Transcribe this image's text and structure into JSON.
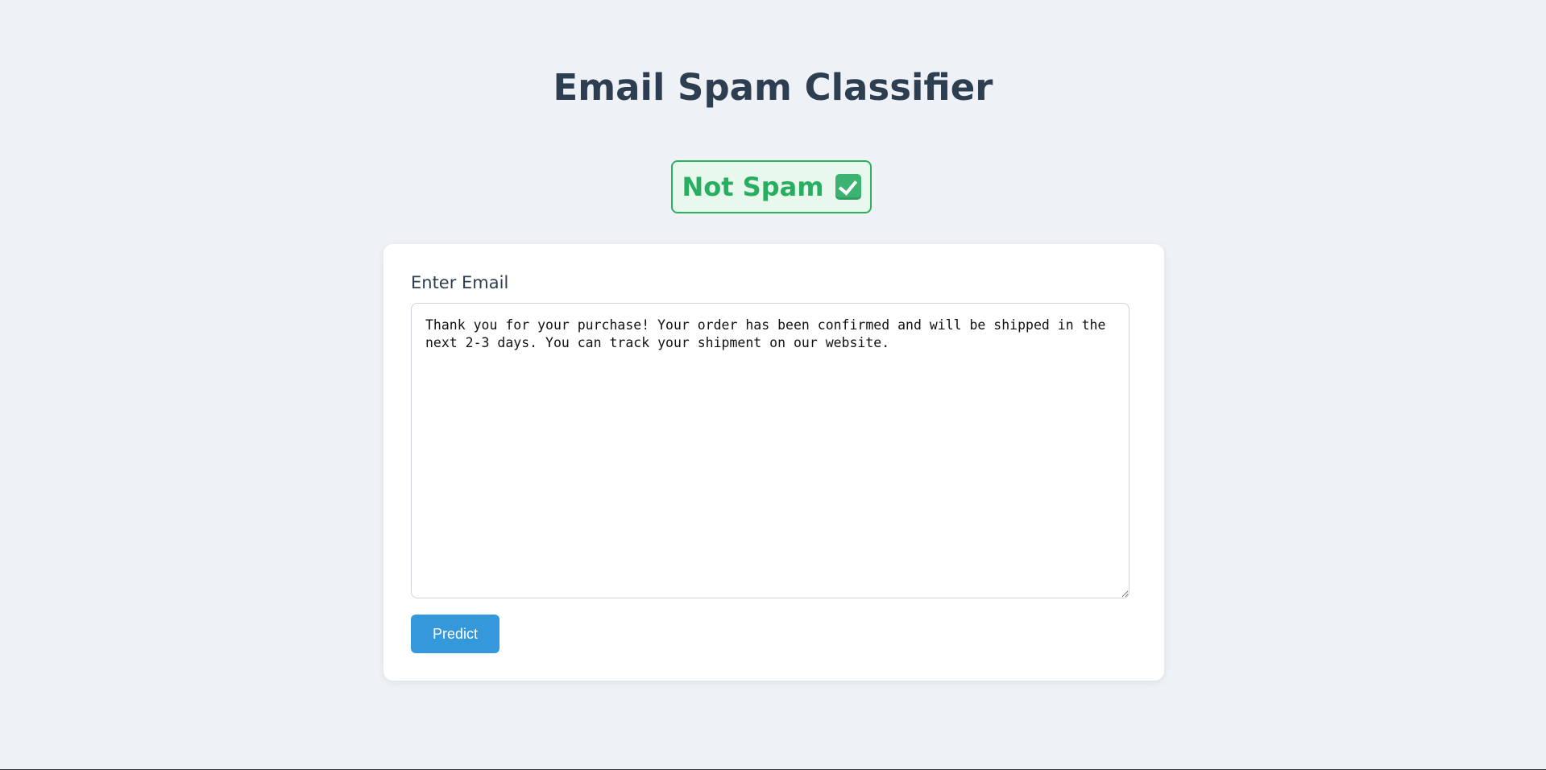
{
  "header": {
    "title": "Email Spam Classifier"
  },
  "result": {
    "label": "Not Spam",
    "icon": "check-mark-icon",
    "color": "#27ae60",
    "background": "#e8f8ec"
  },
  "form": {
    "label": "Enter Email",
    "email_value": "Thank you for your purchase! Your order has been confirmed and will be shipped in the next 2-3 days. You can track your shipment on our website.",
    "predict_label": "Predict"
  },
  "colors": {
    "accent": "#3498db",
    "background": "#eef2f7",
    "heading": "#2c3e50"
  }
}
